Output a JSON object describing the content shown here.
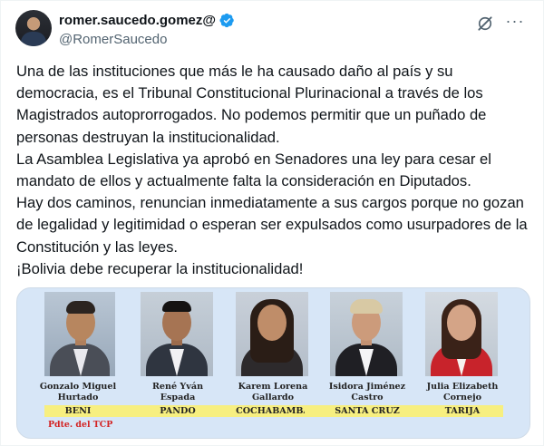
{
  "author": {
    "display_name": "romer.saucedo.gomez@",
    "handle": "@RomerSaucedo",
    "verified_icon": "verified-badge-icon",
    "colors": {
      "verified": "#1d9bf0",
      "handle": "#536471"
    }
  },
  "actions": {
    "grok_icon": "grok-icon",
    "more_icon": "more-options-icon",
    "more_label": "···"
  },
  "tweet": {
    "lines": [
      "Una de las instituciones que más le ha causado daño al país y su democracia, es el Tribunal Constitucional Plurinacional a través de los Magistrados autoprorrogados. No podemos permitir que un puñado de personas destruyan la institucionalidad.",
      "La Asamblea Legislativa ya aprobó en Senadores una ley para cesar el mandato de ellos y actualmente falta la consideración en Diputados.",
      "Hay dos caminos, renuncian inmediatamente a sus cargos porque no gozan de legalidad y legitimidad o esperan ser expulsados como usurpadores de la Constitución y las leyes.",
      "¡Bolivia debe recuperar la institucionalidad!"
    ]
  },
  "media": {
    "background": "#d7e6f7",
    "persons": [
      {
        "name_line1": "Gonzalo Miguel",
        "name_line2": "Hurtado",
        "department": "BENI",
        "note": "Pdte. del TCP"
      },
      {
        "name_line1": "René Yván",
        "name_line2": "Espada",
        "department": "PANDO"
      },
      {
        "name_line1": "Karem Lorena",
        "name_line2": "Gallardo",
        "department": "COCHABAMBA"
      },
      {
        "name_line1": "Isidora Jiménez",
        "name_line2": "Castro",
        "department": "SANTA CRUZ"
      },
      {
        "name_line1": "Julia Elizabeth",
        "name_line2": "Cornejo",
        "department": "TARIJA"
      }
    ]
  }
}
